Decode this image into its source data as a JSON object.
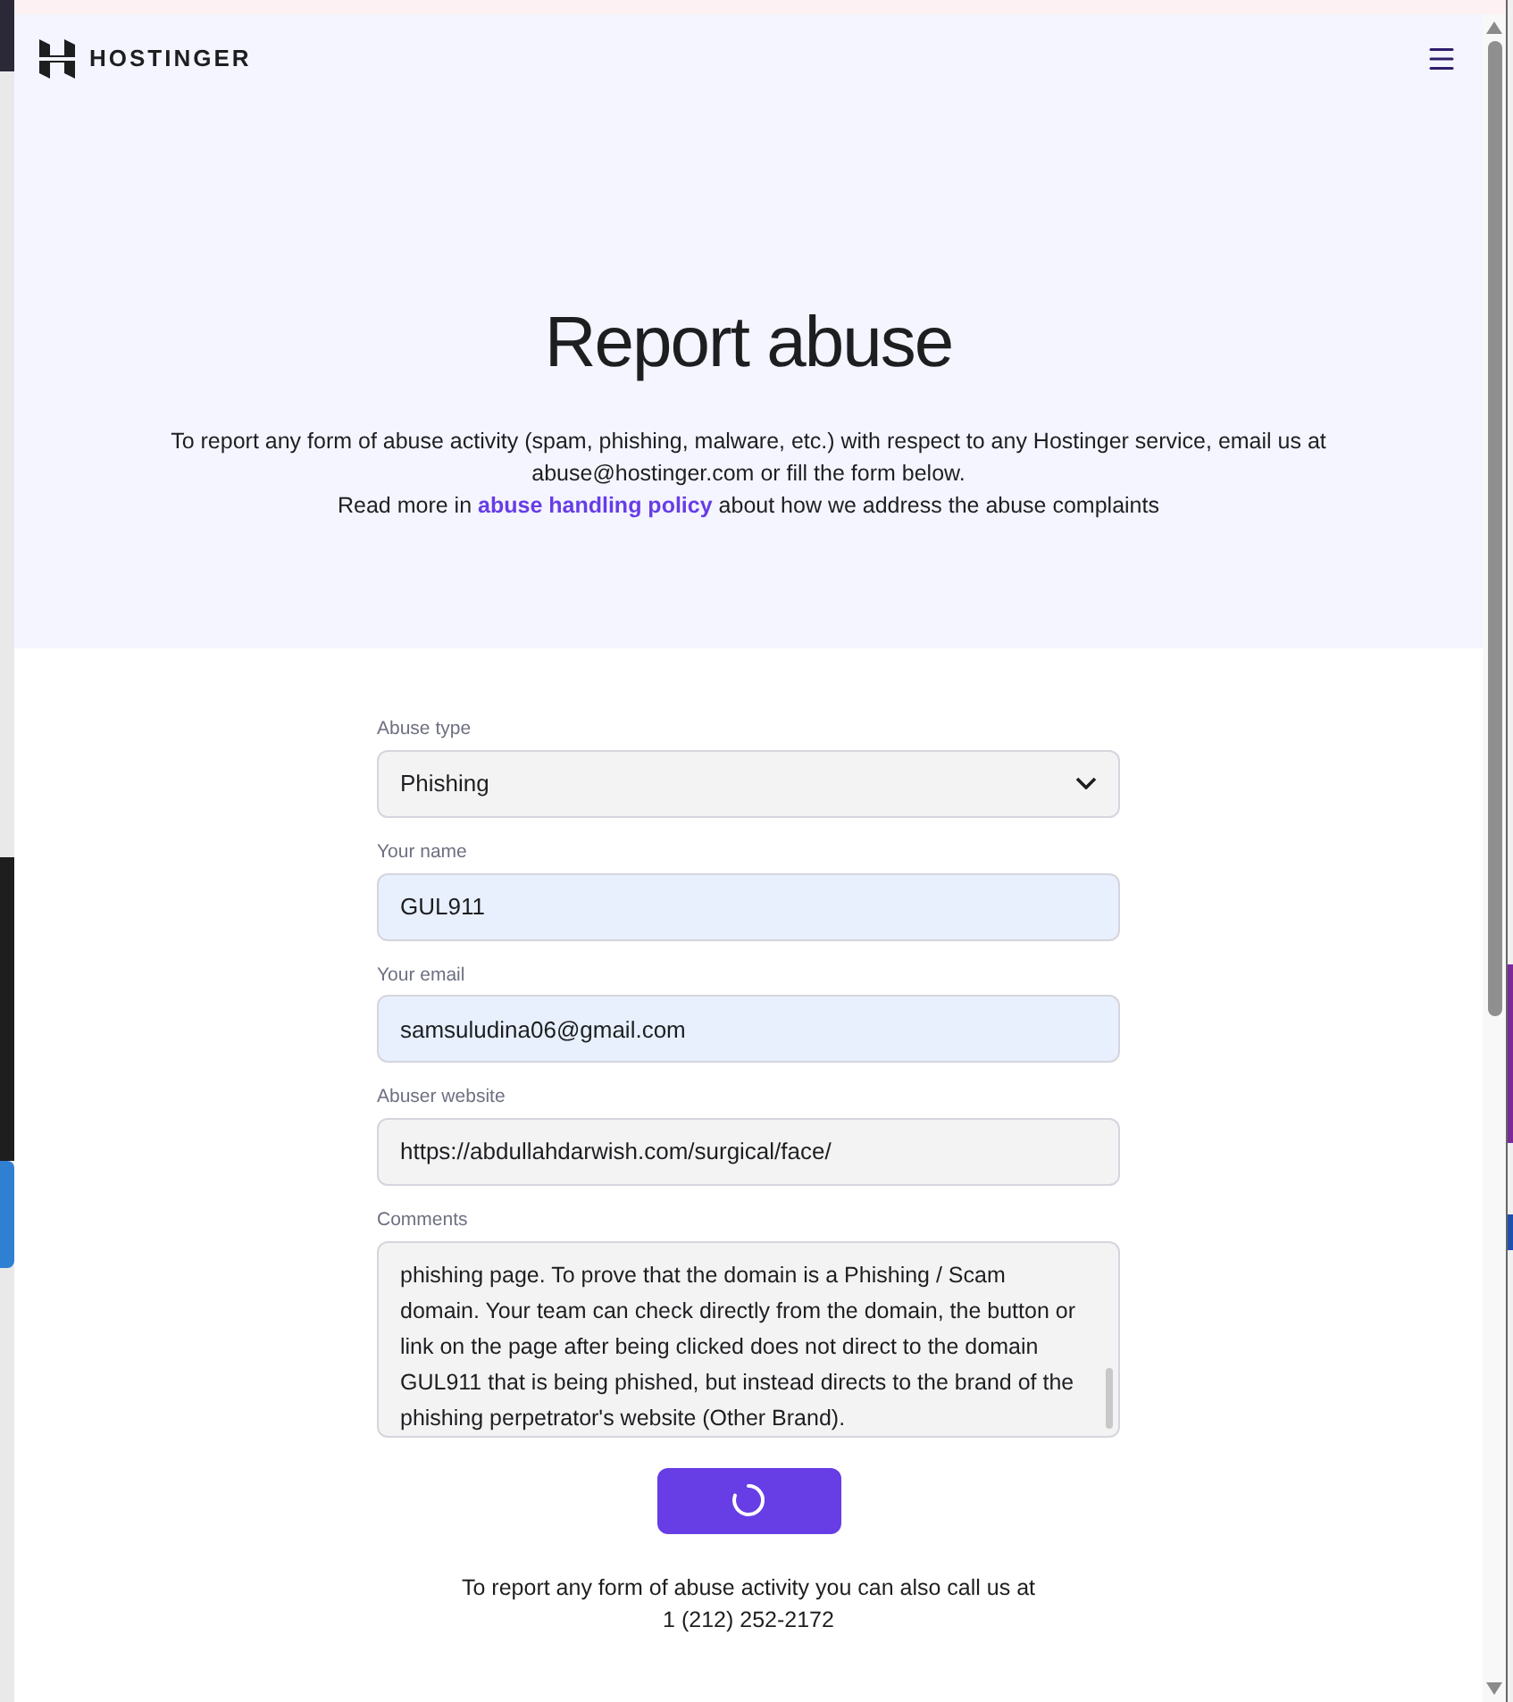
{
  "header": {
    "logo": "HOSTINGER"
  },
  "hero": {
    "title": "Report abuse",
    "intro": "To report any form of abuse activity (spam, phishing, malware, etc.) with respect to any Hostinger service, email us at abuse@hostinger.com or fill the form below.",
    "read_more": {
      "before": "Read more in",
      "link": "abuse handling policy",
      "after": "about how we address the abuse complaints"
    }
  },
  "form": {
    "fields": [
      {
        "kind": "select",
        "label": "Abuse type",
        "value": "Phishing",
        "color": "#f3f3f4"
      },
      {
        "kind": "text",
        "label": "Your name",
        "value": "GUL911",
        "color": "#e8f0fe"
      },
      {
        "kind": "text",
        "label": "Your email",
        "value": "samsuludina06@gmail.com",
        "color": "#e8f0fe"
      },
      {
        "kind": "text",
        "label": "Abuser website",
        "value": "https://abdullahdarwish.com/surgical/face/",
        "color": "#f3f3f4"
      },
      {
        "kind": "textarea",
        "label": "Comments",
        "value": "phishing page. To prove that the domain is a Phishing / Scam domain. Your team can check directly from the domain, the button or link on the page after being clicked does not direct to the domain GUL911 that is being phished, but instead directs to the brand of the phishing perpetrator's website (Other Brand).",
        "color": "#f3f3f4"
      }
    ],
    "submit": {
      "loading": true
    }
  },
  "footer": {
    "text": "To report any form of abuse activity you can also call us at",
    "phone": "1 (212) 252-2172"
  }
}
